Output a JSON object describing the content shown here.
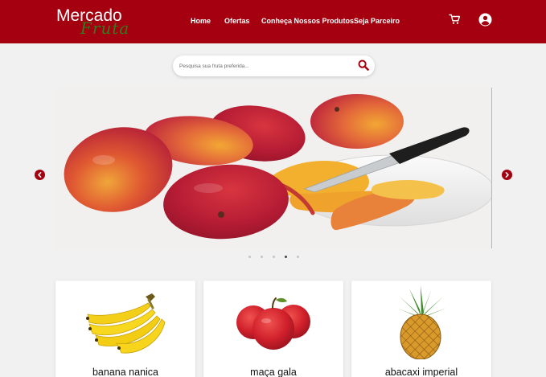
{
  "brand": {
    "name_main": "Mercado",
    "name_sub": "Fruta"
  },
  "nav": {
    "home": "Home",
    "offers": "Ofertas",
    "products": "Conheça Nossos Produtos",
    "partner": "Seja Parceiro"
  },
  "header_icons": {
    "cart": "cart-icon",
    "account": "user-circle-icon"
  },
  "search": {
    "placeholder": "Pesquisa sua fruta preferida..."
  },
  "carousel": {
    "slide_count": 5,
    "active_slide": 4,
    "image": "mangoes-with-knife"
  },
  "products": [
    {
      "name": "banana nanica",
      "image": "bananas"
    },
    {
      "name": "maça gala",
      "image": "apples"
    },
    {
      "name": "abacaxi imperial",
      "image": "pineapple"
    }
  ],
  "colors": {
    "brand_red": "#a4000f",
    "background": "#f1f1f1",
    "logo_green": "#2f7d1f"
  }
}
